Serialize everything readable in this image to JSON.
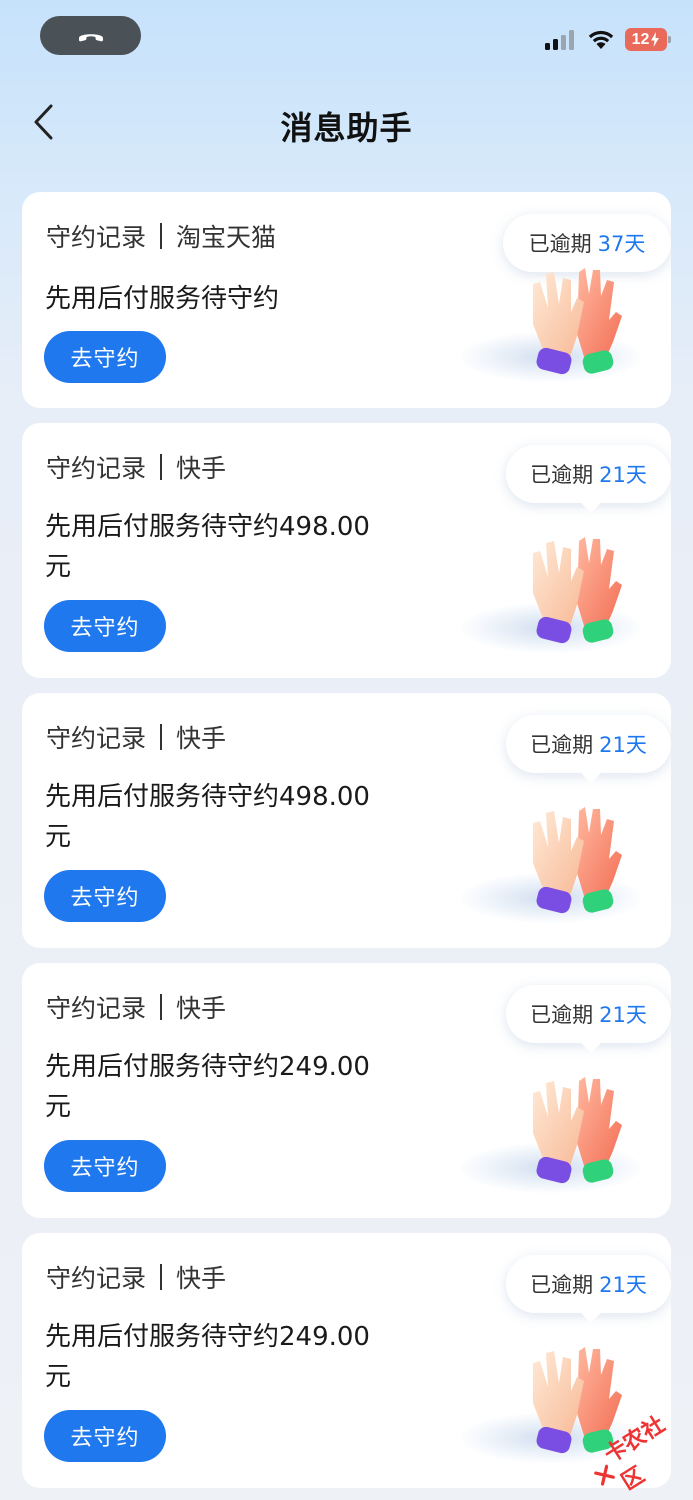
{
  "status_bar": {
    "call_icon": "phone-hangup-icon",
    "signal_icon": "cellular-signal-icon",
    "wifi_icon": "wifi-icon",
    "battery_level": "12"
  },
  "nav": {
    "back_icon": "chevron-left-icon",
    "title": "消息助手"
  },
  "colors": {
    "accent": "#1f78ee",
    "battery": "#e96a5a",
    "watermark": "#e33333"
  },
  "cards": [
    {
      "category": "守约记录",
      "merchant": "淘宝天猫",
      "description": "先用后付服务待守约",
      "button_label": "去守约",
      "overdue_label": "已逾期",
      "overdue_days": "37天"
    },
    {
      "category": "守约记录",
      "merchant": "快手",
      "description": "先用后付服务待守约498.00元",
      "button_label": "去守约",
      "overdue_label": "已逾期",
      "overdue_days": "21天"
    },
    {
      "category": "守约记录",
      "merchant": "快手",
      "description": "先用后付服务待守约498.00元",
      "button_label": "去守约",
      "overdue_label": "已逾期",
      "overdue_days": "21天"
    },
    {
      "category": "守约记录",
      "merchant": "快手",
      "description": "先用后付服务待守约249.00元",
      "button_label": "去守约",
      "overdue_label": "已逾期",
      "overdue_days": "21天"
    },
    {
      "category": "守约记录",
      "merchant": "快手",
      "description": "先用后付服务待守约249.00元",
      "button_label": "去守约",
      "overdue_label": "已逾期",
      "overdue_days": "21天"
    }
  ],
  "watermark": {
    "text": "卡农社区"
  }
}
